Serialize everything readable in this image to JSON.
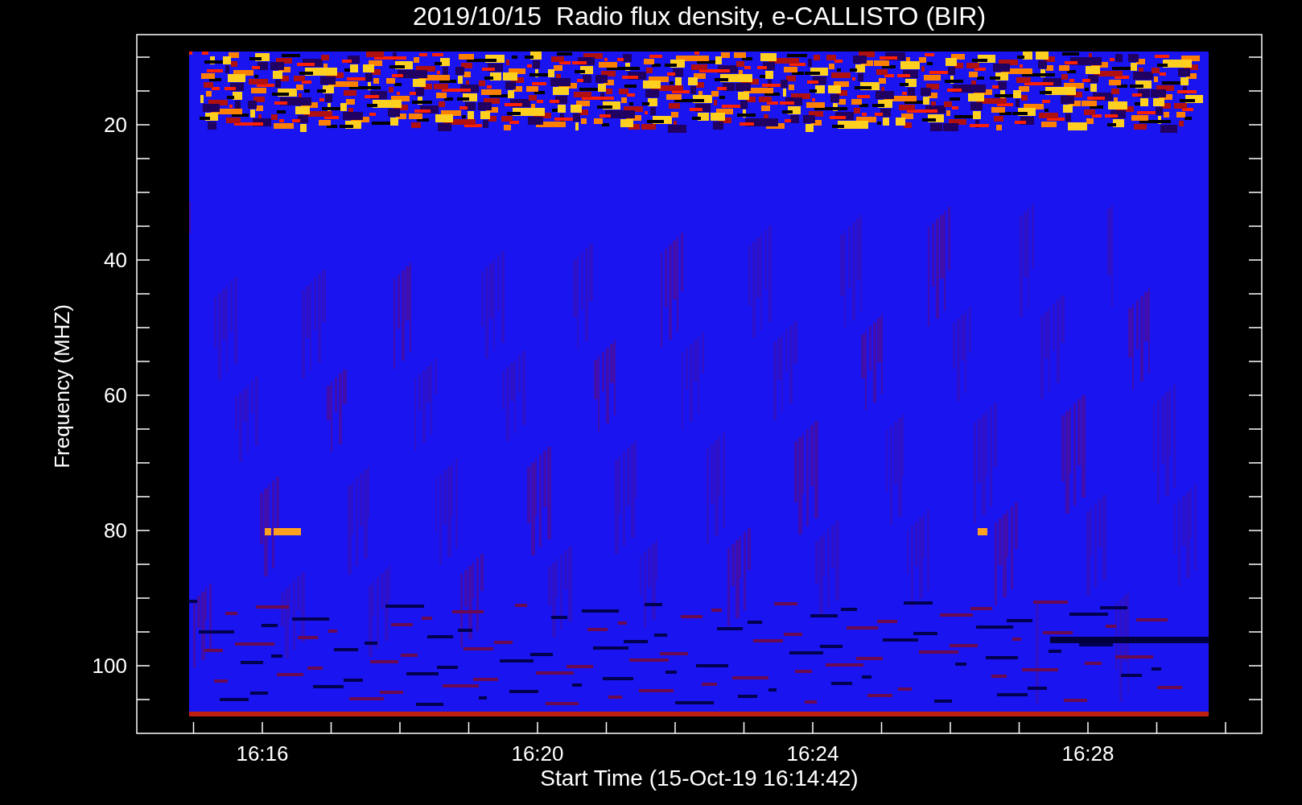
{
  "plot": {
    "title": "2019/10/15  Radio flux density, e-CALLISTO (BIR)",
    "ylabel": "Frequency (MHZ)",
    "xlabel": "Start Time (15-Oct-19 16:14:42)",
    "yticks": [
      "20",
      "40",
      "60",
      "80",
      "100"
    ],
    "xticks": [
      "16:16",
      "16:20",
      "16:24",
      "16:28"
    ]
  }
}
